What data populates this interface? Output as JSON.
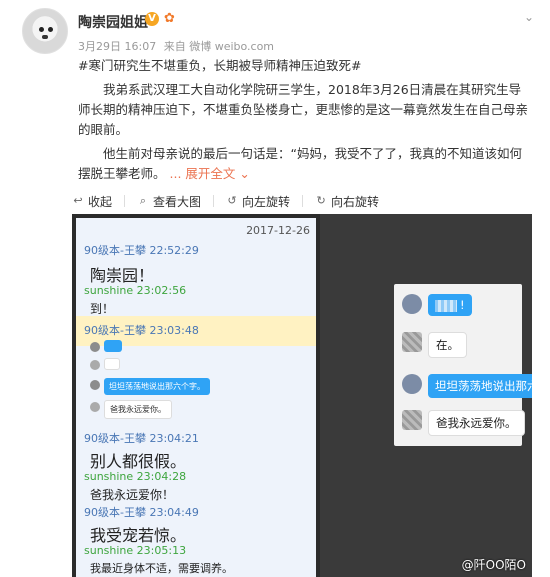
{
  "post": {
    "username": "陶崇园姐姐",
    "meta_time": "3月29日 16:07",
    "meta_source": "来自 微博 weibo.com",
    "hashtags": "#寒门研究生不堪重负，长期被导师精神压迫致死#",
    "para1": "我弟系武汉理工大自动化学院研三学生，2018年3月26日清晨在其研究生导师长期的精神压迫下，不堪重负坠楼身亡，更悲惨的是这一幕竟然发生在自己母亲的眼前。",
    "para2": "他生前对母亲说的最后一句话是：“妈妈，我受不了了，我真的不知道该如何摆脱王攀老师。",
    "expand": "... 展开全文 ⌄"
  },
  "toolbar": {
    "collapse": "收起",
    "view_large": "查看大图",
    "rotate_left": "向左旋转",
    "rotate_right": "向右旋转"
  },
  "chat": {
    "date": "2017-12-26",
    "m1_head": "90级本-王攀 22:52:29",
    "m1_body": "陶崇园！",
    "m2_head": "sunshine 23:02:56",
    "m2_body": "到！",
    "m3_head": "90级本-王攀 23:03:48",
    "m4_head": "90级本-王攀 23:04:21",
    "m4_body": "别人都很假。",
    "m5_head": "sunshine 23:04:28",
    "m5_body": "爸我永远爱你！",
    "m6_head": "90级本-王攀 23:04:49",
    "m6_body": "我受宠若惊。",
    "m7_head": "sunshine 23:05:13",
    "m7_body": "我最近身体不适，需要调养。",
    "mini1": "坦坦荡荡地说出那六个字。",
    "mini2": "爸我永远爱你。"
  },
  "popup": {
    "b1": "!",
    "b2": "在。",
    "b3": "坦坦荡荡地说出那六个字。",
    "b4": "爸我永远爱你。"
  },
  "watermark": "@阡OO陌O"
}
